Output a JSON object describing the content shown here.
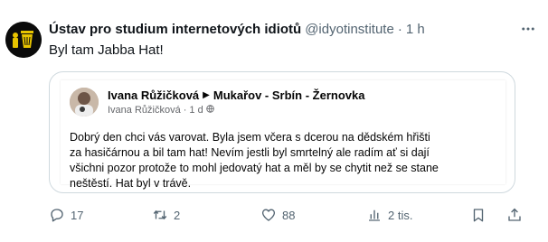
{
  "tweet": {
    "author_name": "Ústav pro studium internetových idiotů",
    "author_handle": "@idyotinstitute",
    "separator": "·",
    "time": "1 h",
    "text": "Byl tam Jabba Hat!"
  },
  "quoted_post": {
    "author": "Ivana Růžičková",
    "group": "Mukařov - Srbín - Žernovka",
    "sub_author": "Ivana Růžičková",
    "sub_time": "1 d",
    "sub_separator": "·",
    "body": "Dobrý den chci vás varovat. Byla jsem včera s dcerou na dědském hřišti za hasičárnou a bil tam hat! Nevím jestli byl smrtelný ale radím ať si dají všichni pozor protože to mohl jedovatý hat a měl by se chytit než se stane neštěstí. Hat byl v trávě."
  },
  "actions": {
    "replies": "17",
    "reposts": "2",
    "likes": "88",
    "views": "2 tis."
  },
  "colors": {
    "text": "#0f1419",
    "secondary": "#536471",
    "border": "#cfd9de"
  },
  "icons": [
    "more-icon",
    "reply-icon",
    "repost-icon",
    "like-icon",
    "views-icon",
    "bookmark-icon",
    "share-icon",
    "globe-icon"
  ]
}
